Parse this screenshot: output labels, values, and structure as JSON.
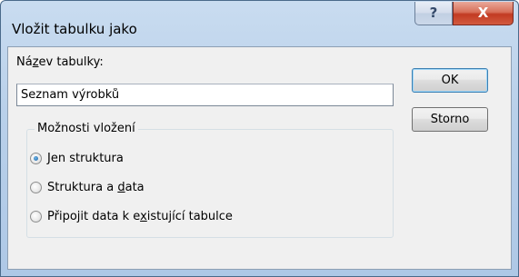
{
  "window": {
    "title": "Vložit tabulku jako",
    "help_glyph": "?",
    "close_glyph": "X"
  },
  "form": {
    "name_label_pre": "Ná",
    "name_label_accel": "z",
    "name_label_post": "ev tabulky:",
    "name_value": "Seznam výrobků"
  },
  "options": {
    "legend": "Možnosti vložení",
    "items": [
      {
        "pre": "",
        "accel": "J",
        "post": "en struktura",
        "checked": true
      },
      {
        "pre": "Struktura a ",
        "accel": "d",
        "post": "ata",
        "checked": false
      },
      {
        "pre": "Připojit data k e",
        "accel": "x",
        "post": "istující tabulce",
        "checked": false
      }
    ]
  },
  "buttons": {
    "ok": "OK",
    "cancel": "Storno"
  }
}
